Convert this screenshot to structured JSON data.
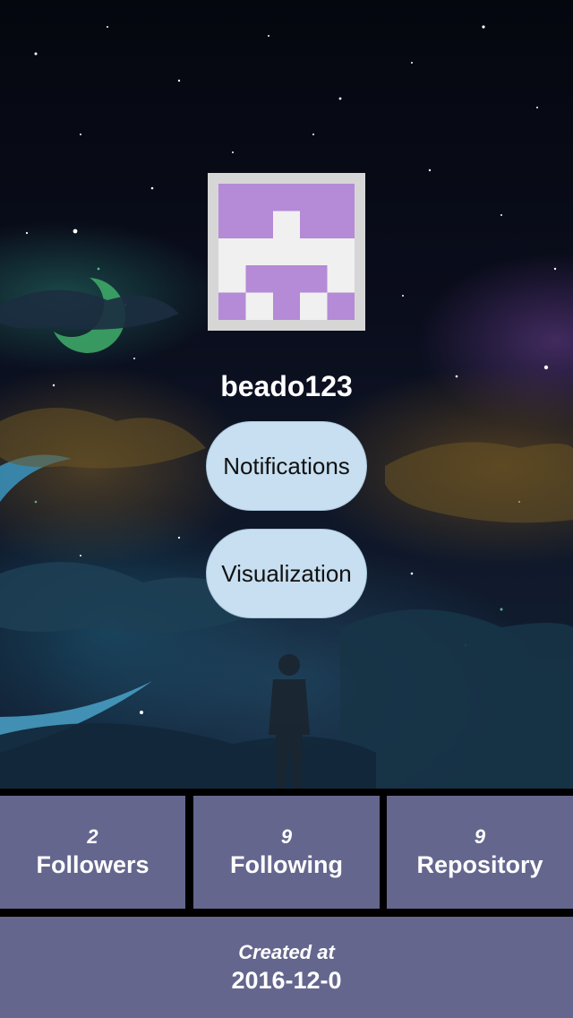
{
  "profile": {
    "username": "beado123",
    "avatar_icon": "identicon-avatar",
    "avatar_color": "#b58ad6"
  },
  "actions": {
    "notifications_label": "Notifications",
    "visualization_label": "Visualization"
  },
  "stats": {
    "followers": {
      "count": "2",
      "label": "Followers"
    },
    "following": {
      "count": "9",
      "label": "Following"
    },
    "repository": {
      "count": "9",
      "label": "Repository"
    }
  },
  "created": {
    "caption": "Created at",
    "date": "2016-12-0"
  },
  "colors": {
    "pill_background": "#c7dff1",
    "stat_background": "#64668e",
    "divider": "#000000"
  }
}
